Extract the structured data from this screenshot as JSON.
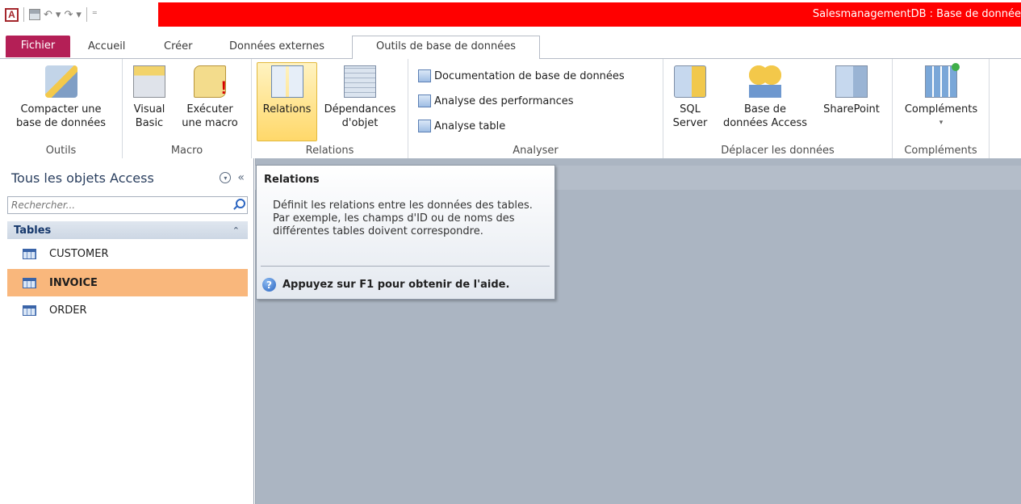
{
  "app": {
    "title": "SalesmanagementDB : Base de donnée",
    "icon_letter": "A"
  },
  "qat": {
    "undo_symbol": "↶",
    "redo_symbol": "↷",
    "dropdown_symbol": "▾",
    "customize_symbol": "⁼"
  },
  "tabs": {
    "file": "Fichier",
    "home": "Accueil",
    "create": "Créer",
    "external": "Données externes",
    "dbtools": "Outils de base de données"
  },
  "ribbon": {
    "outils": {
      "compact_line1": "Compacter une",
      "compact_line2": "base de données",
      "label": "Outils"
    },
    "macro": {
      "vb_line1": "Visual",
      "vb_line2": "Basic",
      "run_line1": "Exécuter",
      "run_line2": "une macro",
      "label": "Macro"
    },
    "relations": {
      "relations": "Relations",
      "dep_line1": "Dépendances",
      "dep_line2": "d'objet",
      "label": "Relations"
    },
    "analyser": {
      "documentation": "Documentation de base de données",
      "performance": "Analyse des performances",
      "table": "Analyse table",
      "label": "Analyser"
    },
    "move": {
      "sql_line1": "SQL",
      "sql_line2": "Server",
      "access_line1": "Base de",
      "access_line2": "données Access",
      "sharepoint": "SharePoint",
      "label": "Déplacer les données"
    },
    "addins": {
      "addins": "Compléments",
      "label": "Compléments",
      "dropdown": "▾"
    }
  },
  "nav": {
    "title": "Tous les objets Access",
    "menu_symbol": "▾",
    "collapse_symbol": "«",
    "search_placeholder": "Rechercher...",
    "category": "Tables",
    "category_toggle": "⌃",
    "items": [
      {
        "label": "CUSTOMER",
        "selected": false
      },
      {
        "label": "INVOICE",
        "selected": true
      },
      {
        "label": "ORDER",
        "selected": false
      }
    ]
  },
  "tooltip": {
    "title": "Relations",
    "description": "Définit les relations entre les données des tables. Par exemple, les champs d'ID ou de noms des différentes tables doivent correspondre.",
    "help_symbol": "?",
    "help": "Appuyez sur F1 pour obtenir de l'aide."
  },
  "colors": {
    "title_bar": "#ff0000",
    "file_tab": "#b41f56",
    "selected_item": "#f9b77c",
    "workspace": "#abb5c2"
  }
}
